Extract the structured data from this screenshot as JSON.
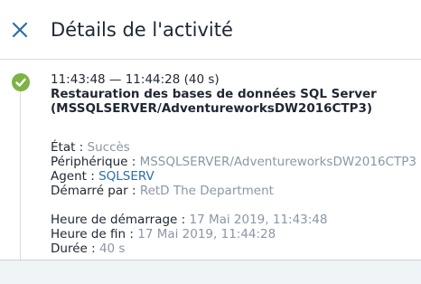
{
  "header": {
    "title": "Détails de l'activité",
    "close_icon": "close-icon"
  },
  "activity": {
    "status_icon": "check-circle-icon",
    "status_color": "#7cb342",
    "time_range": "11:43:48 — 11:44:28 (40 s)",
    "name_line1": "Restauration des bases de données SQL Server",
    "name_line2": "(MSSQLSERVER/AdventureworksDW2016CTP3)",
    "details": {
      "etat_label": "État : ",
      "etat_value": "Succès",
      "peripherique_label": "Périphérique : ",
      "peripherique_value": "MSSQLSERVER/AdventureworksDW2016CTP3",
      "agent_label": "Agent : ",
      "agent_value": "SQLSERV",
      "demarre_par_label": "Démarré par : ",
      "demarre_par_value": "RetD The Department"
    },
    "timing": {
      "debut_label": "Heure de démarrage : ",
      "debut_value": "17 Mai 2019, 11:43:48",
      "fin_label": "Heure de fin : ",
      "fin_value": "17 Mai 2019, 11:44:28",
      "duree_label": "Durée : ",
      "duree_value": "40 s"
    }
  },
  "colors": {
    "accent": "#2d6fa7",
    "muted": "#8a97a5",
    "text": "#1f2733",
    "success": "#7cb342"
  }
}
